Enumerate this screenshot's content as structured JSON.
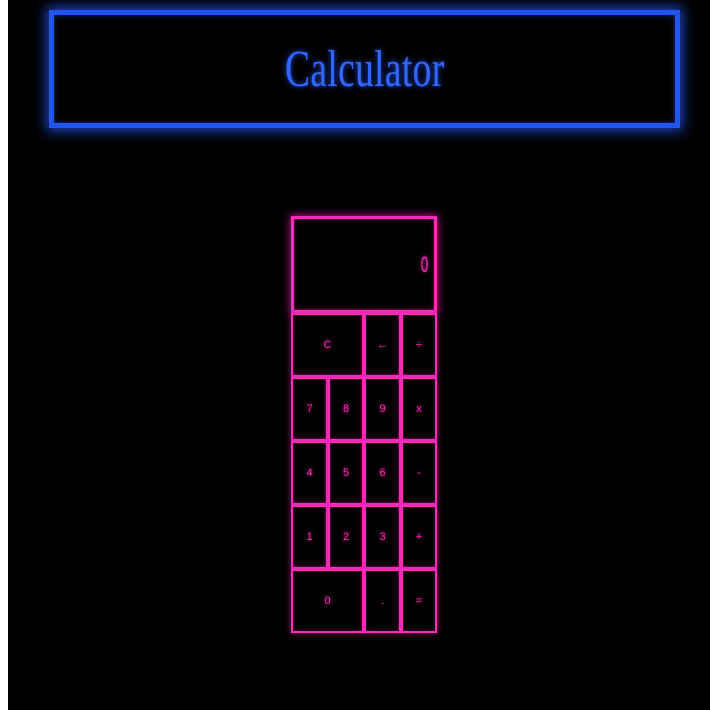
{
  "header": {
    "title": "Calculator"
  },
  "display": {
    "value": "0"
  },
  "keys": {
    "clear": "C",
    "backspace": "←",
    "divide": "÷",
    "seven": "7",
    "eight": "8",
    "nine": "9",
    "multiply": "x",
    "four": "4",
    "five": "5",
    "six": "6",
    "subtract": "-",
    "one": "1",
    "two": "2",
    "three": "3",
    "add": "+",
    "zero": "0",
    "decimal": ".",
    "equals": "="
  },
  "colors": {
    "header_border": "#2255f0",
    "header_text": "#3366ff",
    "calculator_accent": "#ff2ab8",
    "background": "#000000"
  }
}
